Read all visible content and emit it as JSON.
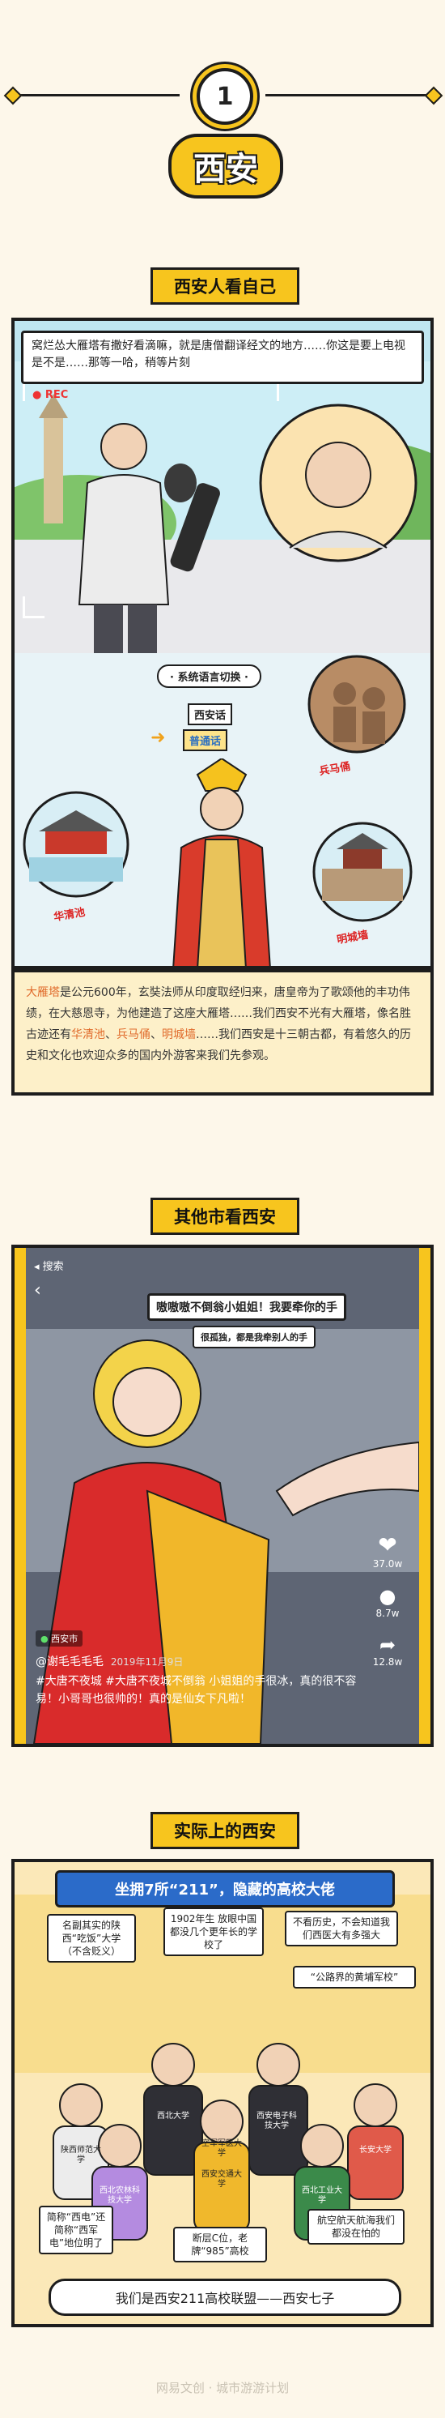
{
  "header": {
    "number": "1",
    "city": "西安"
  },
  "section1": {
    "title": "西安人看自己",
    "speech": "窝烂怂大雁塔有撒好看滴嘛，就是唐僧翻译经文的地方……你这是要上电视是不是……那等一哈，稍等片刻",
    "rec_label": "REC",
    "system_label": "· 系统语言切换 ·",
    "lang_xian": "西安话",
    "lang_mandarin": "普通话",
    "callout_bingmayong": "兵马俑",
    "callout_huaqingchi": "华清池",
    "callout_mingchengqiang": "明城墙",
    "info_parts": [
      {
        "t": "大雁塔",
        "h": true
      },
      {
        "t": "是公元600年，玄奘法师从印度取经归来，唐皇帝为了歌颂他的丰功伟绩，在大慈恩寺，为他建造了这座大雁塔……我们西安不光有大雁塔，像名胜古迹还有",
        "h": false
      },
      {
        "t": "华清池",
        "h": true
      },
      {
        "t": "、",
        "h": false
      },
      {
        "t": "兵马俑",
        "h": true
      },
      {
        "t": "、",
        "h": false
      },
      {
        "t": "明城墙",
        "h": true
      },
      {
        "t": "……我们西安是十三朝古都，有着悠久的历史和文化也欢迎众多的国内外游客来我们先参观。",
        "h": false
      }
    ]
  },
  "section2": {
    "title": "其他市看西安",
    "search_label": "搜索",
    "bubble1": "嗷嗷嗷不倒翁小姐姐！我要牵你的手",
    "bubble2": "很孤独，都是我牵别人的手",
    "location": "西安市",
    "user": "@谢毛毛毛毛",
    "date": "2019年11月9日",
    "caption": "#大唐不夜城 #大唐不夜城不倒翁 小姐姐的手很冰，真的很不容易！小哥哥也很帅的！真的是仙女下凡啦！",
    "likes": "37.0w",
    "comments": "8.7w",
    "shares": "12.8w"
  },
  "section3": {
    "title": "实际上的西安",
    "banner": "坐拥7所“211”，隐藏的高校大佬",
    "labels": [
      "名副其实的陕西“吃饭”大学（不含贬义）",
      "1902年生 放眼中国都没几个更年长的学校了",
      "不看历史，不会知道我们西医大有多强大",
      "“公路界的黄埔军校”",
      "简称“西电”还简称“西军电”地位明了",
      "断层C位，老牌“985”高校",
      "航空航天航海我们都没在怕的"
    ],
    "shirts": [
      "陕西师范大学",
      "西北大学",
      "西安交通大学",
      "长安大学",
      "西北农林科技大学",
      "西安电子科技大学",
      "西北工业大学",
      "空军军医大学"
    ],
    "bottom": "我们是西安211高校联盟——西安七子"
  },
  "footer": "网易文创 · 城市游游计划",
  "colors": {
    "accent": "#f7c51e",
    "ink": "#1d1d1d",
    "highlight": "#e06a2a",
    "sky": "#bfe6f1",
    "red": "#d92b2b"
  }
}
